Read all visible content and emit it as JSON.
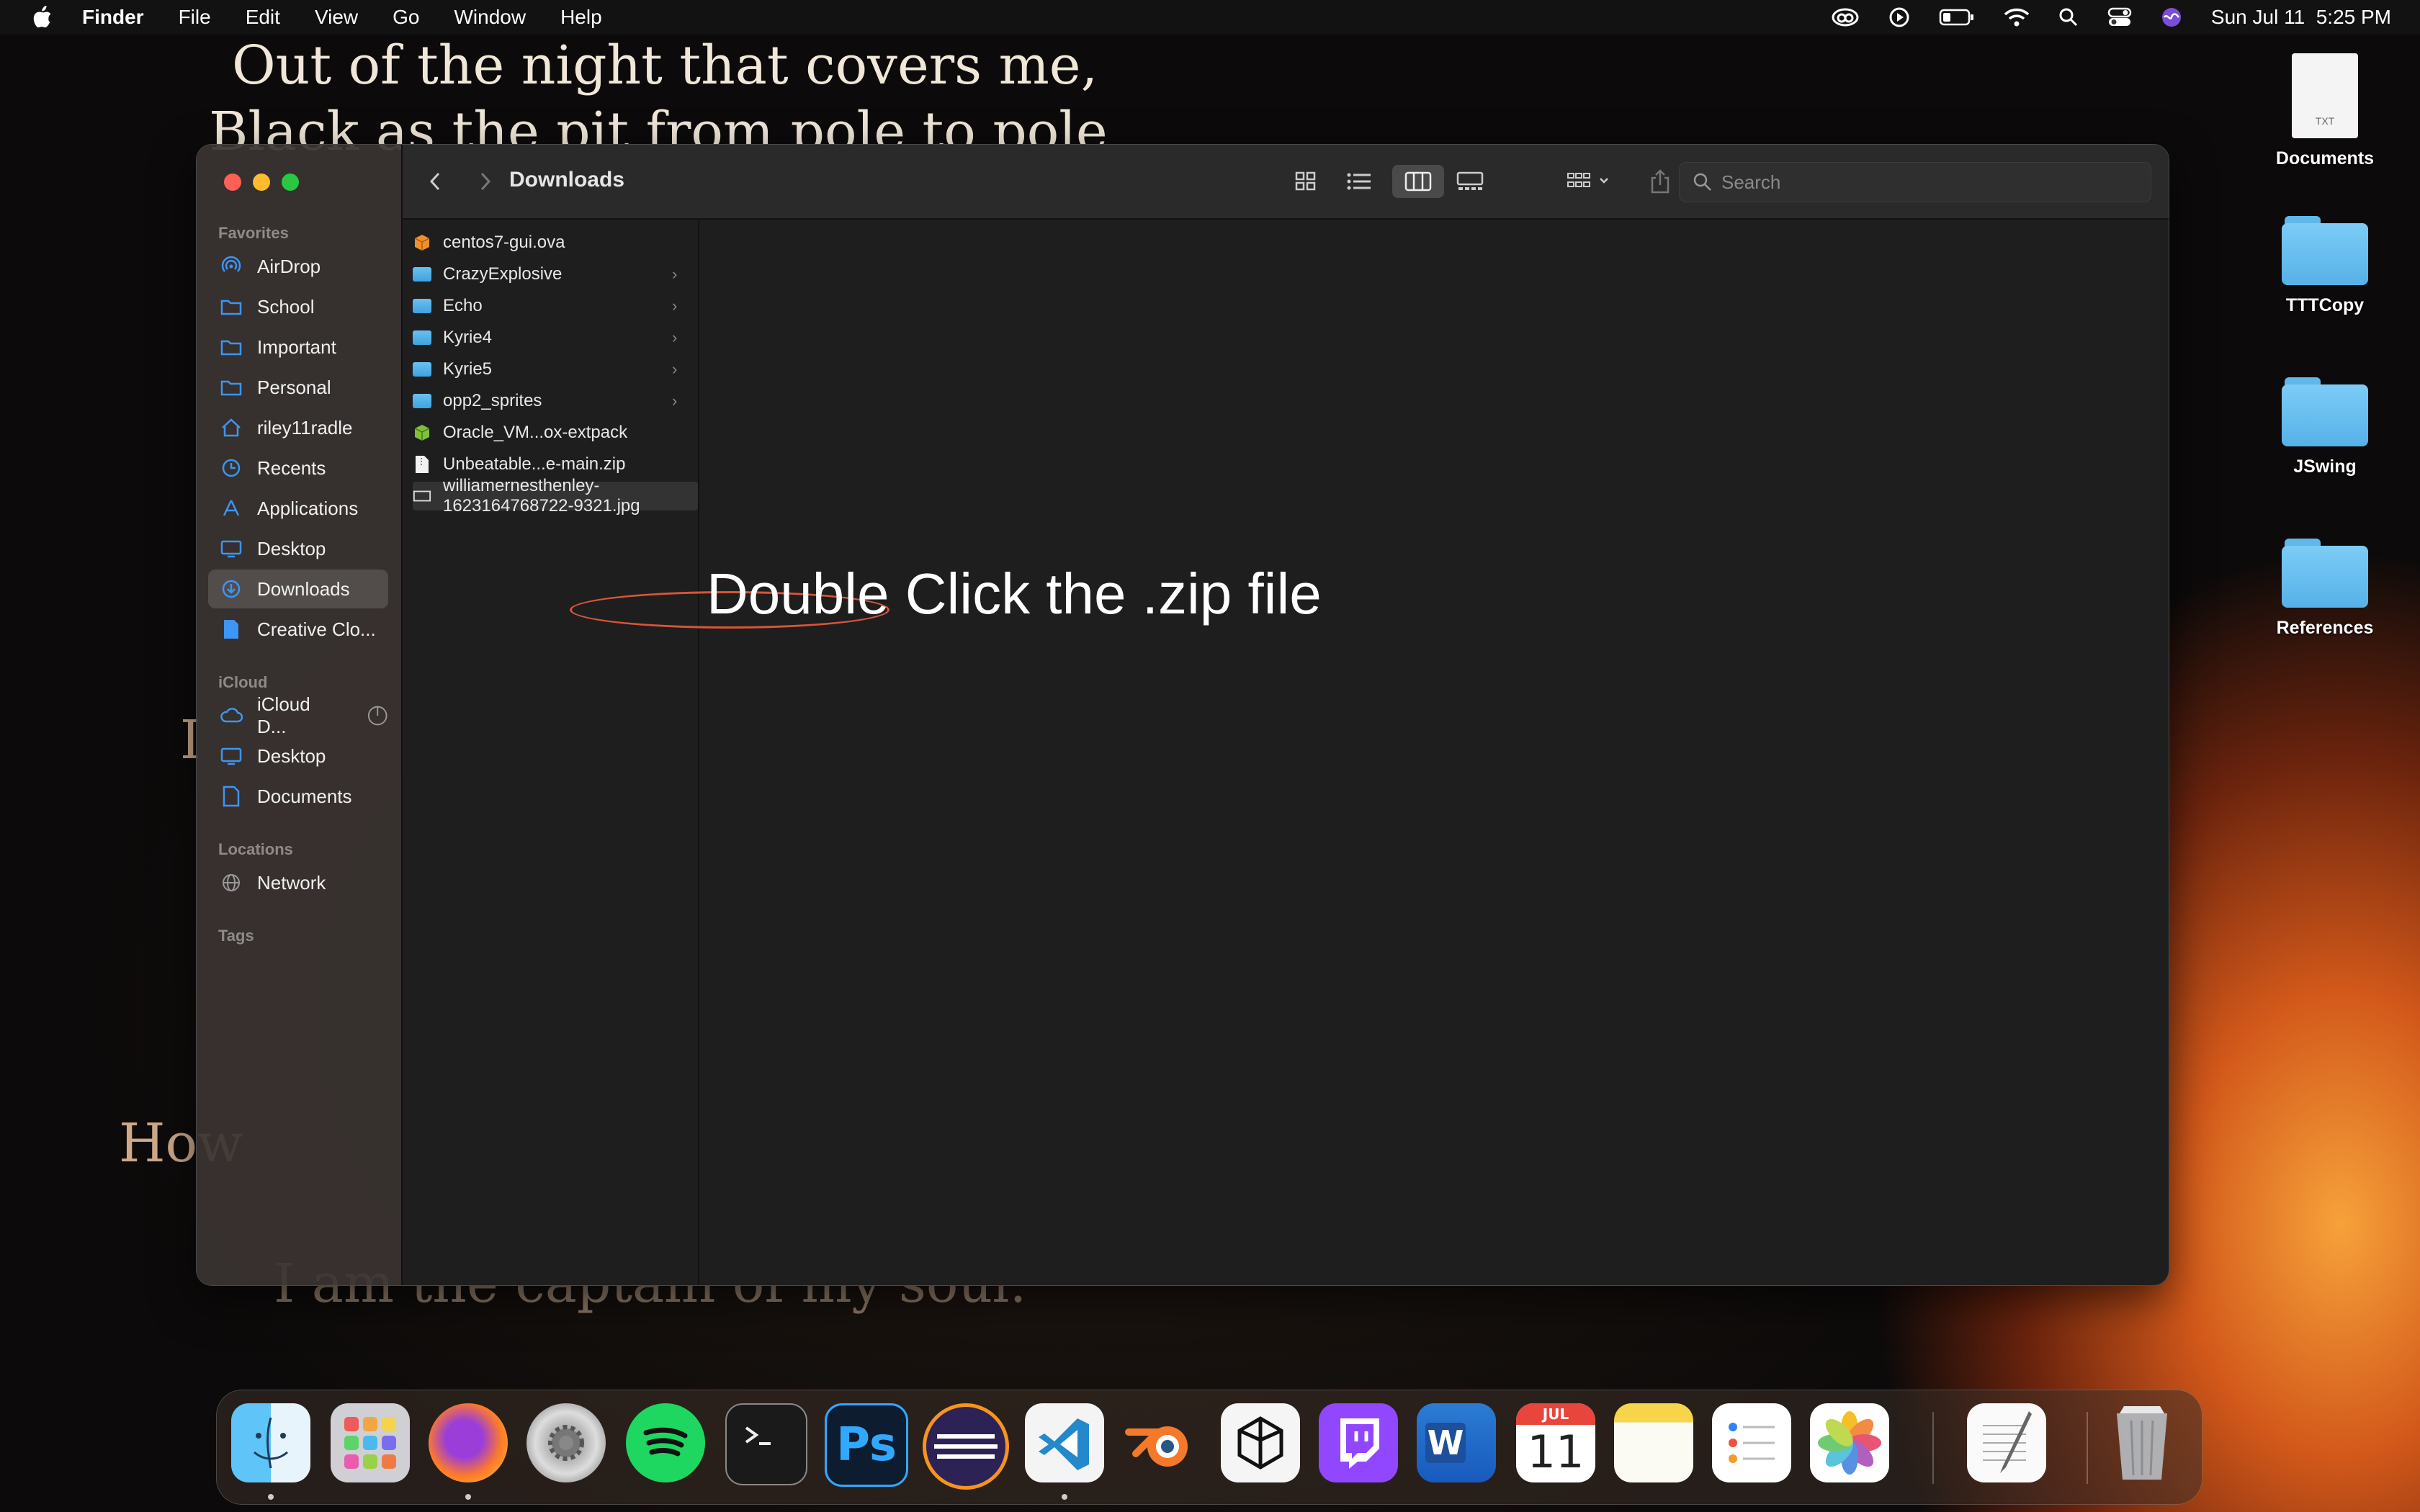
{
  "menubar": {
    "app": "Finder",
    "items": [
      "File",
      "Edit",
      "View",
      "Go",
      "Window",
      "Help"
    ],
    "clock": "Sun Jul 11  5:25 PM"
  },
  "wallpaper": {
    "line1": "Out of the night that covers me,",
    "line2": "Black as the pit from pole to pole,",
    "frag_i": "I",
    "frag_how": "How",
    "line_last": "I am the captain of my soul."
  },
  "desktop_icons": [
    {
      "label": "Documents",
      "type": "txt",
      "badge": "TXT"
    },
    {
      "label": "TTTCopy",
      "type": "folder"
    },
    {
      "label": "JSwing",
      "type": "folder"
    },
    {
      "label": "References",
      "type": "folder"
    }
  ],
  "finder": {
    "title": "Downloads",
    "search_placeholder": "Search",
    "sidebar": {
      "favorites_header": "Favorites",
      "favorites": [
        "AirDrop",
        "School",
        "Important",
        "Personal",
        "riley11radle",
        "Recents",
        "Applications",
        "Desktop",
        "Downloads",
        "Creative Clo..."
      ],
      "icloud_header": "iCloud",
      "icloud": [
        "iCloud D...",
        "Desktop",
        "Documents"
      ],
      "locations_header": "Locations",
      "locations": [
        "Network"
      ],
      "tags_header": "Tags",
      "selected": "Downloads"
    },
    "files": [
      {
        "name": "centos7-gui.ova",
        "kind": "ova"
      },
      {
        "name": "CrazyExplosive",
        "kind": "folder"
      },
      {
        "name": "Echo",
        "kind": "folder"
      },
      {
        "name": "Kyrie4",
        "kind": "folder"
      },
      {
        "name": "Kyrie5",
        "kind": "folder"
      },
      {
        "name": "opp2_sprites",
        "kind": "folder"
      },
      {
        "name": "Oracle_VM...ox-extpack",
        "kind": "extpack"
      },
      {
        "name": "Unbeatable...e-main.zip",
        "kind": "zip"
      },
      {
        "name": "williamernesthenley-1623164768722-9321.jpg",
        "kind": "jpg"
      }
    ],
    "annotation": "Double Click the .zip file"
  },
  "dock": {
    "apps": [
      "Finder",
      "Launchpad",
      "Firefox",
      "System Preferences",
      "Spotify",
      "Terminal",
      "Photoshop",
      "Eclipse",
      "Visual Studio Code",
      "Blender",
      "Unity Hub",
      "Twitch",
      "Microsoft Word",
      "Calendar",
      "Notes",
      "Reminders",
      "Photos",
      "TextEdit",
      "Trash"
    ],
    "calendar_month": "JUL",
    "calendar_day": "11",
    "ps_label": "Ps",
    "word_label": "W"
  }
}
